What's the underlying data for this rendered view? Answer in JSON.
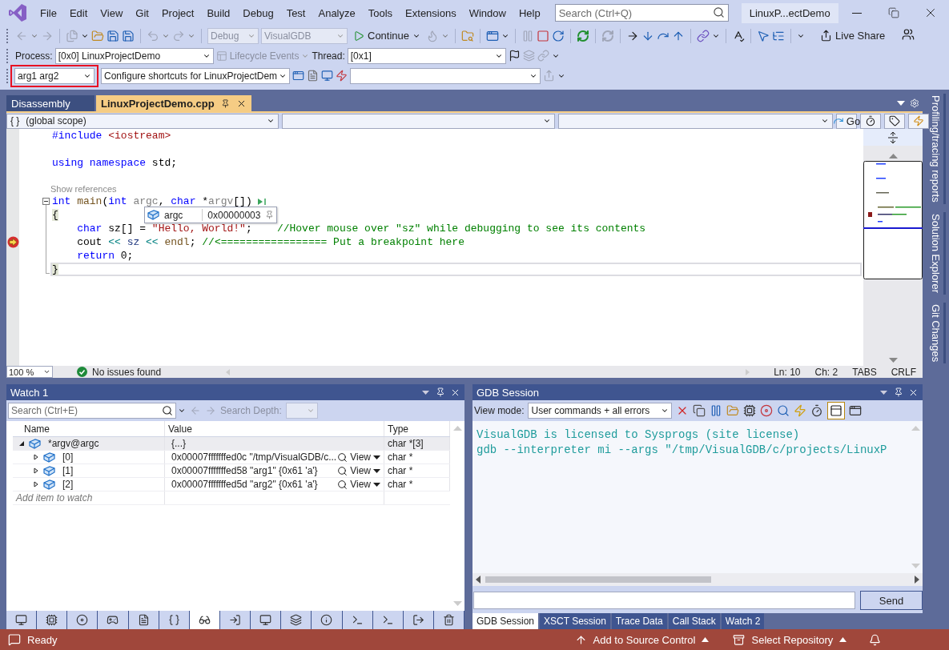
{
  "menu": [
    "File",
    "Edit",
    "View",
    "Git",
    "Project",
    "Build",
    "Debug",
    "Test",
    "Analyze",
    "Tools",
    "Extensions",
    "Window",
    "Help"
  ],
  "search": {
    "placeholder": "Search (Ctrl+Q)"
  },
  "solution_title": "LinuxP...ectDemo",
  "standard_toolbar": {
    "configuration": {
      "value": "Debug",
      "disabled": true
    },
    "platform": {
      "value": "VisualGDB",
      "disabled": true
    },
    "continue": "Continue",
    "live_share": "Live Share"
  },
  "debug_location": {
    "process_label": "Process:",
    "process": "[0x0] LinuxProjectDemo",
    "lifecycle": {
      "label": "Lifecycle Events",
      "disabled": true
    },
    "thread_label": "Thread:",
    "thread": "[0x1]"
  },
  "shortcuts_bar": {
    "arguments": {
      "value": "arg1 arg2",
      "highlighted": true
    },
    "shortcuts": "Configure shortcuts for LinuxProjectDem"
  },
  "doc_tabs": [
    {
      "label": "Disassembly",
      "selected": false
    },
    {
      "label": "LinuxProjectDemo.cpp",
      "selected": true
    }
  ],
  "nav_bar": {
    "scope_glyph": "{ }",
    "scope": "(global scope)",
    "go": "Go"
  },
  "code": {
    "lines": [
      {
        "kind": "code",
        "current": false,
        "cursor": false,
        "tokens": [
          {
            "text": "#include",
            "kind": "keyword"
          },
          {
            "text": " <iostream>",
            "kind": "string"
          }
        ]
      },
      {
        "kind": "blank",
        "current": false,
        "cursor": false
      },
      {
        "kind": "code",
        "current": false,
        "cursor": false,
        "tokens": [
          {
            "text": "using namespace",
            "kind": "keyword"
          },
          {
            "text": " std;",
            "kind": "text"
          }
        ]
      },
      {
        "kind": "blank",
        "current": false,
        "cursor": false
      },
      {
        "kind": "lens",
        "text": "Show references"
      },
      {
        "kind": "code",
        "current": false,
        "cursor": false,
        "fold": true,
        "run_marker": true,
        "tokens": [
          {
            "text": "int",
            "kind": "keyword"
          },
          {
            "text": " main",
            "kind": "func"
          },
          {
            "text": "(",
            "kind": "text"
          },
          {
            "text": "int",
            "kind": "keyword"
          },
          {
            "text": " argc",
            "kind": "param"
          },
          {
            "text": ", ",
            "kind": "text"
          },
          {
            "text": "char",
            "kind": "keyword"
          },
          {
            "text": " *",
            "kind": "text"
          },
          {
            "text": "argv",
            "kind": "param"
          },
          {
            "text": "[])",
            "kind": "text"
          }
        ]
      },
      {
        "kind": "code",
        "current": false,
        "cursor": false,
        "fold": true,
        "tokens": [
          {
            "text": "{",
            "kind": "brace"
          }
        ]
      },
      {
        "kind": "code",
        "current": false,
        "cursor": false,
        "fold": true,
        "tokens": [
          {
            "text": "    char",
            "kind": "keyword"
          },
          {
            "text": " sz[] = ",
            "kind": "text"
          },
          {
            "text": "\"Hello, World!\"",
            "kind": "string"
          },
          {
            "text": ";    ",
            "kind": "text"
          },
          {
            "text": "//Hover mouse over \"sz\" while debugging to see its contents",
            "kind": "comment"
          }
        ]
      },
      {
        "kind": "code",
        "current": true,
        "cursor": false,
        "fold": true,
        "tokens": [
          {
            "text": "    cout ",
            "kind": "text"
          },
          {
            "text": "<<",
            "kind": "operator"
          },
          {
            "text": " sz ",
            "kind": "variable"
          },
          {
            "text": "<<",
            "kind": "operator"
          },
          {
            "text": " endl",
            "kind": "func"
          },
          {
            "text": "; ",
            "kind": "text"
          },
          {
            "text": "//<================= Put a breakpoint here",
            "kind": "comment"
          }
        ]
      },
      {
        "kind": "code",
        "current": false,
        "cursor": false,
        "fold": true,
        "tokens": [
          {
            "text": "    return",
            "kind": "keyword"
          },
          {
            "text": " 0;",
            "kind": "text"
          }
        ]
      },
      {
        "kind": "code",
        "current": false,
        "cursor": true,
        "fold": true,
        "tokens": [
          {
            "text": "}",
            "kind": "brace"
          }
        ]
      }
    ],
    "datatip": {
      "name": "argc",
      "value": "0x00000003"
    }
  },
  "editor_status": {
    "zoom": "100 %",
    "issues": "No issues found",
    "line": "Ln: 10",
    "column": "Ch: 2",
    "indent": "TABS",
    "line_ending": "CRLF"
  },
  "side_tabs": [
    "Profiling/tracing reports",
    "Solution Explorer",
    "Git Changes"
  ],
  "watch": {
    "title": "Watch 1",
    "search_placeholder": "Search (Ctrl+E)",
    "depth_label": "Search Depth:",
    "columns": [
      "Name",
      "Value",
      "Type"
    ],
    "rows": [
      {
        "name": "*argv@argc",
        "value": "{...}",
        "type": "char *[3]",
        "expanded": true,
        "selected": true,
        "children": [
          {
            "name": "[0]",
            "value": "0x00007fffffffed0c \"/tmp/VisualGDB/c...",
            "view": "View",
            "type": "char *",
            "expanded": false,
            "selected": false
          },
          {
            "name": "[1]",
            "value": "0x00007fffffffed58 \"arg1\" {0x61 'a'}",
            "view": "View",
            "type": "char *",
            "expanded": false,
            "selected": false
          },
          {
            "name": "[2]",
            "value": "0x00007fffffffed5d \"arg2\" {0x61 'a'}",
            "view": "View",
            "type": "char *",
            "expanded": false,
            "selected": false
          }
        ]
      }
    ],
    "add_placeholder": "Add item to watch"
  },
  "tool_windows": [
    {
      "selected": false
    },
    {
      "selected": false
    },
    {
      "selected": false
    },
    {
      "selected": false
    },
    {
      "selected": false
    },
    {
      "selected": false
    },
    {
      "selected": true
    },
    {
      "selected": false
    },
    {
      "selected": false
    },
    {
      "selected": false
    },
    {
      "selected": false
    },
    {
      "selected": false
    },
    {
      "selected": false
    },
    {
      "selected": false
    },
    {
      "selected": false
    }
  ],
  "gdb": {
    "title": "GDB Session",
    "view_mode_label": "View mode:",
    "view_mode": "User commands + all errors",
    "output": [
      "VisualGDB is licensed to Sysprogs (site license)",
      "gdb --interpreter mi --args \"/tmp/VisualGDB/c/projects/LinuxP"
    ],
    "send": "Send"
  },
  "bottom_tabs": [
    {
      "label": "GDB Session",
      "selected": true
    },
    {
      "label": "XSCT Session",
      "selected": false
    },
    {
      "label": "Trace Data",
      "selected": false
    },
    {
      "label": "Call Stack",
      "selected": false
    },
    {
      "label": "Watch 2",
      "selected": false
    }
  ],
  "status_bar": {
    "state": "Ready",
    "source_control": "Add to Source Control",
    "repository": "Select Repository"
  }
}
